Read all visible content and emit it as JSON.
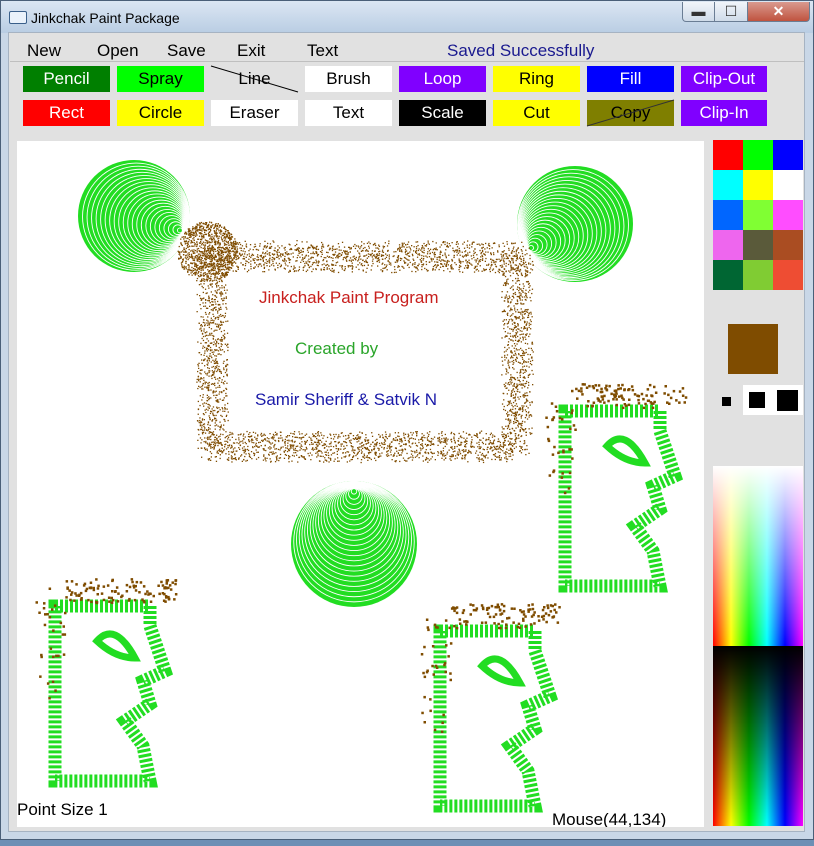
{
  "window": {
    "title": "Jinkchak Paint Package",
    "min_glyph": "▬",
    "max_glyph": "☐",
    "close_glyph": "✕"
  },
  "menu": [
    {
      "id": "new",
      "label": "New"
    },
    {
      "id": "open",
      "label": "Open"
    },
    {
      "id": "save",
      "label": "Save"
    },
    {
      "id": "exit",
      "label": "Exit"
    },
    {
      "id": "text",
      "label": "Text"
    }
  ],
  "status": "Saved Successfully",
  "tools_row1": [
    {
      "id": "pencil",
      "label": "Pencil",
      "bg": "#007f00",
      "fg": "#ffffff"
    },
    {
      "id": "spray",
      "label": "Spray",
      "bg": "#00ff00",
      "fg": "#000000"
    },
    {
      "id": "line",
      "label": "Line",
      "bg": "#e1e1e1",
      "fg": "#000000"
    },
    {
      "id": "brush",
      "label": "Brush",
      "bg": "#ffffff",
      "fg": "#000000"
    },
    {
      "id": "loop",
      "label": "Loop",
      "bg": "#8000ff",
      "fg": "#ffffff"
    },
    {
      "id": "ring",
      "label": "Ring",
      "bg": "#ffff00",
      "fg": "#000000"
    },
    {
      "id": "fill",
      "label": "Fill",
      "bg": "#0000ff",
      "fg": "#ffffff"
    },
    {
      "id": "clip-out",
      "label": "Clip-Out",
      "bg": "#8000ff",
      "fg": "#ffffff"
    }
  ],
  "tools_row2": [
    {
      "id": "rect",
      "label": "Rect",
      "bg": "#ff0000",
      "fg": "#ffffff"
    },
    {
      "id": "circle",
      "label": "Circle",
      "bg": "#ffff00",
      "fg": "#000000"
    },
    {
      "id": "eraser",
      "label": "Eraser",
      "bg": "#ffffff",
      "fg": "#000000"
    },
    {
      "id": "text",
      "label": "Text",
      "bg": "#ffffff",
      "fg": "#000000"
    },
    {
      "id": "scale",
      "label": "Scale",
      "bg": "#000000",
      "fg": "#ffffff"
    },
    {
      "id": "cut",
      "label": "Cut",
      "bg": "#ffff00",
      "fg": "#000000"
    },
    {
      "id": "copy",
      "label": "Copy",
      "bg": "#7f7f00",
      "fg": "#000000"
    },
    {
      "id": "clip-in",
      "label": "Clip-In",
      "bg": "#8000ff",
      "fg": "#ffffff"
    }
  ],
  "palette": [
    "#ff0000",
    "#00ff00",
    "#0000ff",
    "#00ffff",
    "#ffff00",
    "#ffffff",
    "#0066ff",
    "#80ff33",
    "#ff4dff",
    "#ee66ee",
    "#5a5a3a",
    "#aa4d22",
    "#006633",
    "#80cc33",
    "#ee4d33"
  ],
  "current_color": "#7f4c00",
  "canvas": {
    "text_lines": [
      {
        "text": "Jinkchak Paint Program",
        "color": "#c8201e"
      },
      {
        "text": "Created by",
        "color": "#2aa52a"
      },
      {
        "text": "Samir Sheriff & Satvik N",
        "color": "#1a1aa8"
      }
    ],
    "spray_color": "#7f4c00",
    "shape_color": "#22dd22"
  },
  "footer": {
    "point_size": "Point Size 1",
    "mouse": "Mouse(44,134)"
  }
}
